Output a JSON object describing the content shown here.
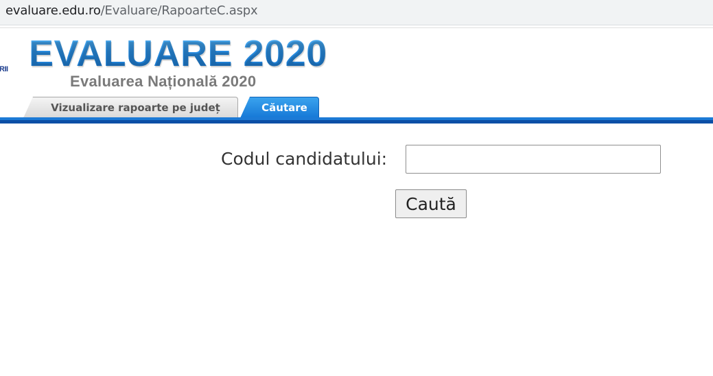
{
  "browser": {
    "url_host": "evaluare.edu.ro",
    "url_path": "/Evaluare/RapoarteC.aspx"
  },
  "header": {
    "edge_logo_text": "RII",
    "brand_title": "EVALUARE 2020",
    "brand_subtitle": "Evaluarea Națională 2020"
  },
  "tabs": [
    {
      "label": "Vizualizare rapoarte pe județ",
      "active": false
    },
    {
      "label": "Căutare",
      "active": true
    }
  ],
  "search": {
    "label": "Codul candidatului:",
    "input_value": "",
    "button_label": "Caută"
  },
  "colors": {
    "brand_blue": "#2b8fdf",
    "active_tab": "#1678d6",
    "tab_bar": "#0b4fa6",
    "subtitle_gray": "#7a7a7a"
  }
}
